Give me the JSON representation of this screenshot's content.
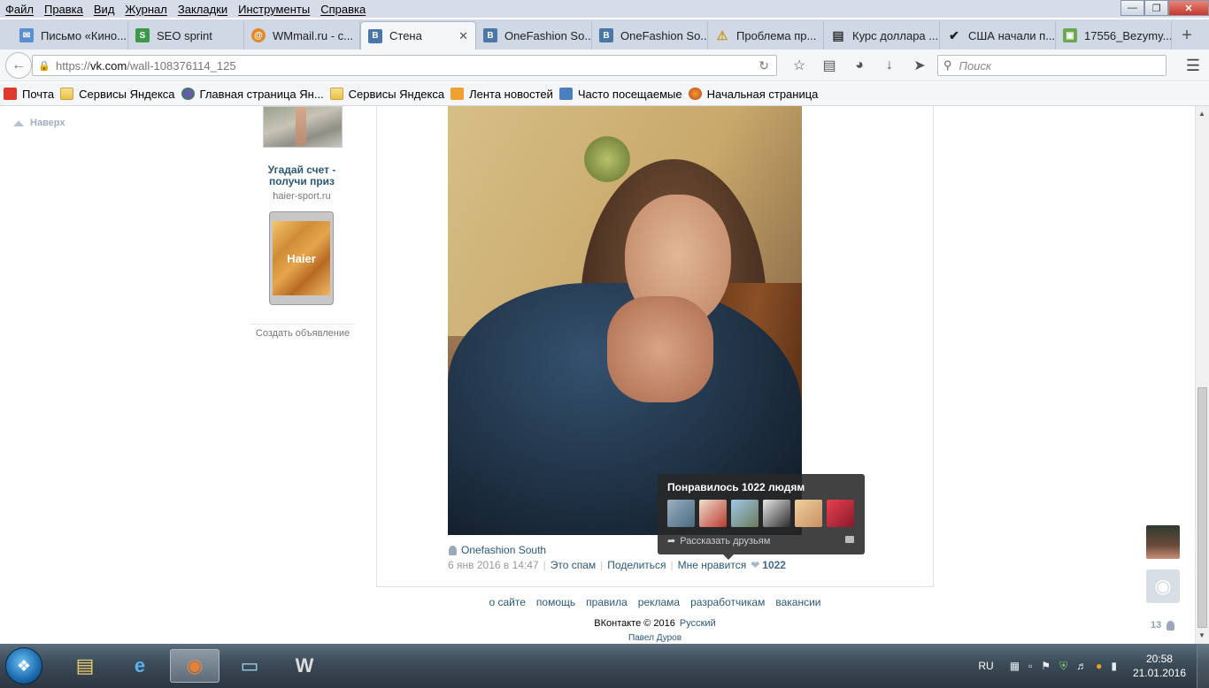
{
  "menu": [
    "Файл",
    "Правка",
    "Вид",
    "Журнал",
    "Закладки",
    "Инструменты",
    "Справка"
  ],
  "tabs": [
    {
      "title": "Письмо «Кино...",
      "icon": "mail-icon",
      "color": "#5b8fd1"
    },
    {
      "title": "SEO sprint",
      "icon": "seosprint-icon",
      "color": "#3a9a4a"
    },
    {
      "title": "WMmail.ru - с...",
      "icon": "wmmail-icon",
      "color": "#e08a2a"
    },
    {
      "title": "Стена",
      "icon": "vk-icon",
      "color": "#4a76a8",
      "active": true
    },
    {
      "title": "OneFashion So...",
      "icon": "vk-icon",
      "color": "#4a76a8"
    },
    {
      "title": "OneFashion So...",
      "icon": "vk-icon",
      "color": "#4a76a8"
    },
    {
      "title": "Проблема пр...",
      "icon": "warning-icon",
      "color": "#e0b020"
    },
    {
      "title": "Курс доллара ...",
      "icon": "news-icon",
      "color": "#333333"
    },
    {
      "title": "США начали п...",
      "icon": "check-icon",
      "color": "#222222"
    },
    {
      "title": "17556_Bezymy...",
      "icon": "image-icon",
      "color": "#6aa84f"
    }
  ],
  "url": {
    "scheme": "https://",
    "host": "vk.com",
    "path": "/wall-108376114_125"
  },
  "search_placeholder": "Поиск",
  "bookmarks": [
    {
      "label": "Почта",
      "icon": "yandex-icon"
    },
    {
      "label": "Сервисы Яндекса",
      "icon": "folder-icon"
    },
    {
      "label": "Главная страница Ян...",
      "icon": "globe-icon"
    },
    {
      "label": "Сервисы Яндекса",
      "icon": "folder-icon"
    },
    {
      "label": "Лента новостей",
      "icon": "rss-icon"
    },
    {
      "label": "Часто посещаемые",
      "icon": "frequent-icon"
    },
    {
      "label": "Начальная страница",
      "icon": "firefox-icon"
    }
  ],
  "page": {
    "to_top": "Наверх",
    "ad": {
      "title": "Угадай счет - получи приз",
      "domain": "haier-sport.ru",
      "brand": "Haier",
      "create_ad": "Создать объявление"
    },
    "post": {
      "author": "Onefashion South",
      "date": "6 янв 2016 в 14:47",
      "spam": "Это спам",
      "share": "Поделиться",
      "like": "Мне нравится",
      "like_count": "1022"
    },
    "like_popup": {
      "title": "Понравилось 1022 людям",
      "share_label": "Рассказать друзьям",
      "avatar_colors": [
        "#6a8aa0",
        "#b83a2e",
        "#7a9a6a",
        "#5a5a5a",
        "#d9a870",
        "#b8283a"
      ]
    },
    "footer": {
      "links": [
        "о сайте",
        "помощь",
        "правила",
        "реклама",
        "разработчикам",
        "вакансии"
      ],
      "copyright": "ВКонтакте © 2016",
      "language": "Русский",
      "founder": "Павел Дуров"
    },
    "friends_count": "13"
  },
  "taskbar": {
    "lang": "RU",
    "time": "20:58",
    "date": "21.01.2016"
  }
}
